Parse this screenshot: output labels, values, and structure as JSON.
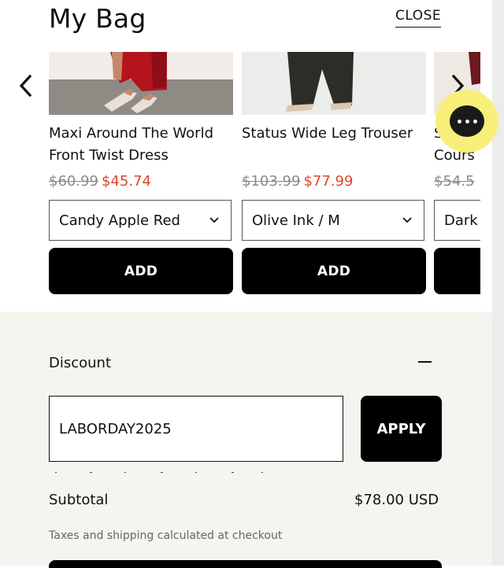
{
  "header": {
    "title": "My Bag",
    "close_label": "CLOSE"
  },
  "carousel": {
    "items": [
      {
        "name": "Maxi Around The World Front Twist Dress",
        "price_old": "$60.99",
        "price_new": "$45.74",
        "variant": "Candy Apple Red",
        "add_label": "ADD"
      },
      {
        "name": "Status Wide Leg Trouser",
        "price_old": "$103.99",
        "price_new": "$77.99",
        "variant": "Olive Ink / M",
        "add_label": "ADD"
      },
      {
        "name": "Stretc Cours",
        "price_old": "$54.5",
        "price_new": "",
        "variant": "Dark",
        "add_label": ""
      }
    ]
  },
  "discount": {
    "label": "Discount",
    "code_value": "LABORDAY2025",
    "apply_label": "APPLY"
  },
  "summary": {
    "subtotal_label": "Subtotal",
    "subtotal_value": "$78.00 USD",
    "tax_note": "Taxes and shipping calculated at checkout"
  },
  "colors": {
    "sale_price": "#e0452c",
    "chat_bubble": "#f8ef7a",
    "button_bg": "#000000",
    "bottom_panel": "#f6f4ef"
  }
}
